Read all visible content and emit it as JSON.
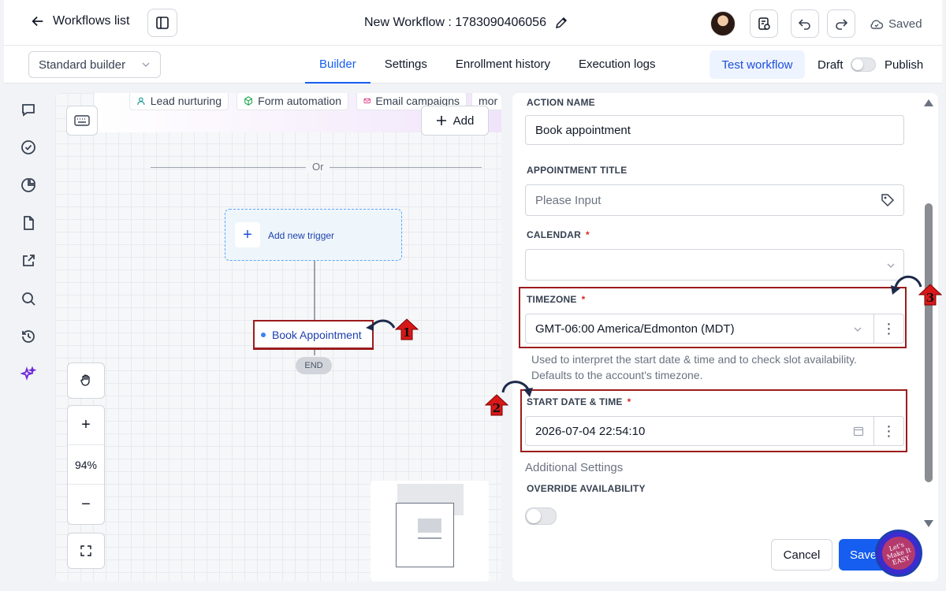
{
  "header": {
    "back_label": "Workflows list",
    "workflow_title": "New Workflow : 1783090406056",
    "save_status": "Saved"
  },
  "subbar": {
    "builder_mode": "Standard builder",
    "tabs": [
      {
        "label": "Builder",
        "active": true
      },
      {
        "label": "Settings",
        "active": false
      },
      {
        "label": "Enrollment history",
        "active": false
      },
      {
        "label": "Execution logs",
        "active": false
      }
    ],
    "test_label": "Test workflow",
    "draft_label": "Draft",
    "publish_label": "Publish"
  },
  "canvas": {
    "chips": [
      "Lead nurturing",
      "Form automation",
      "Email campaigns",
      "mor"
    ],
    "add_label": "Add",
    "or_label": "Or",
    "add_trigger_label": "Add new trigger",
    "node_label": "Book Appointment",
    "end_label": "END",
    "zoom": "94%"
  },
  "panel": {
    "action_name_label": "ACTION NAME",
    "action_name_value": "Book appointment",
    "appointment_title_label": "APPOINTMENT TITLE",
    "appointment_title_placeholder": "Please Input",
    "calendar_label": "CALENDAR",
    "calendar_value": "",
    "timezone_label": "TIMEZONE",
    "timezone_value": "GMT-06:00 America/Edmonton (MDT)",
    "helper_text_1": "Used to interpret the start date & time and to check slot availability.",
    "helper_text_2": "Defaults to the account's timezone.",
    "start_label": "START DATE & TIME",
    "start_value": "2026-07-04 22:54:10",
    "additional_settings": "Additional Settings",
    "override_label": "OVERRIDE AVAILABILITY",
    "override_on": false,
    "cancel_label": "Cancel",
    "save_label": "Save"
  },
  "annotations": {
    "marker_1": "1",
    "marker_2": "2",
    "marker_3": "3",
    "highlight_color": "#9b1c1c",
    "logo_text": "Let's Make It EASY"
  },
  "colors": {
    "accent": "#155eef",
    "required": "#dc2626"
  }
}
